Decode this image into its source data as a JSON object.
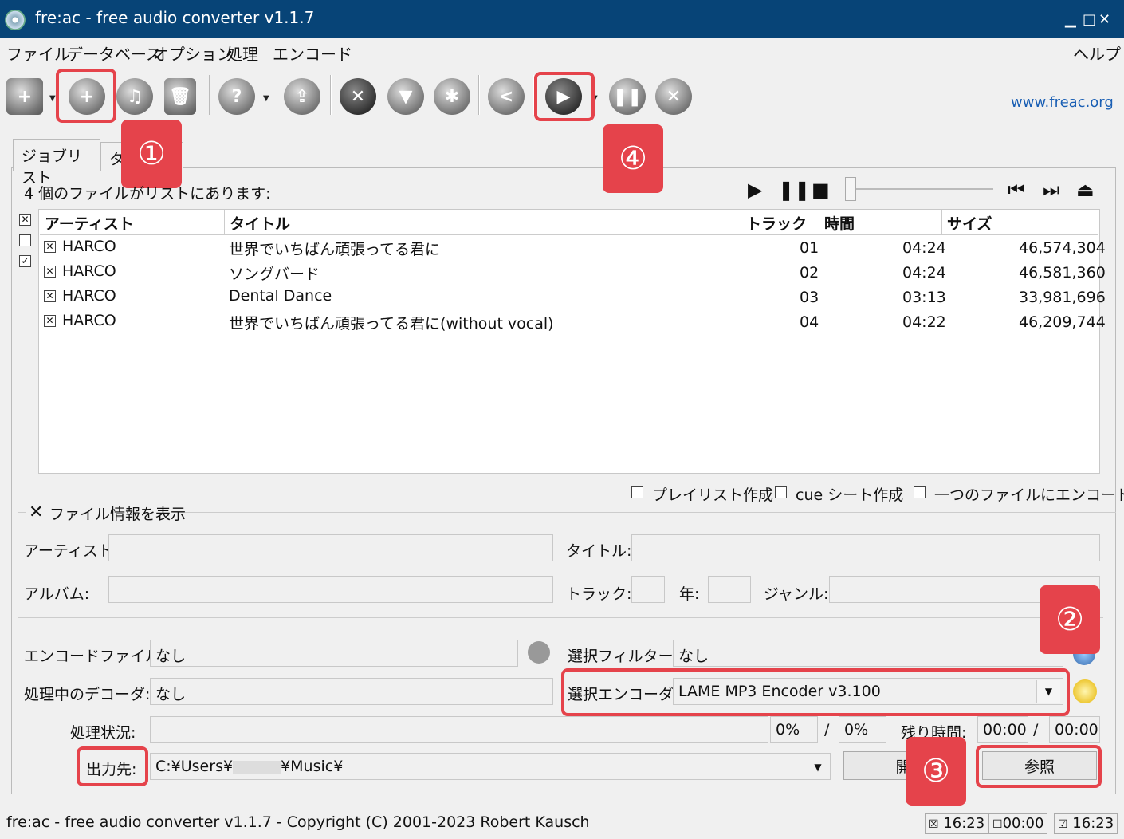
{
  "window": {
    "title": "fre:ac - free audio converter v1.1.7"
  },
  "menu": [
    "ファイル",
    "データベース",
    "オプション",
    "処理",
    "エンコード",
    "ヘルプ"
  ],
  "toolbar": {
    "link": "www.freac.org"
  },
  "badges": {
    "b1": "①",
    "b2": "②",
    "b3": "③",
    "b4": "④"
  },
  "tabs": {
    "joblist": "ジョブリスト",
    "second": "タ"
  },
  "joblist": {
    "count_text": "4 個のファイルがリストにあります:",
    "columns": {
      "artist": "アーティスト",
      "title": "タイトル",
      "track": "トラック",
      "time": "時間",
      "size": "サイズ"
    },
    "rows": [
      {
        "artist": "HARCO",
        "title": "世界でいちばん頑張ってる君に",
        "track": "01",
        "time": "04:24",
        "size": "46,574,304"
      },
      {
        "artist": "HARCO",
        "title": "ソングバード",
        "track": "02",
        "time": "04:24",
        "size": "46,581,360"
      },
      {
        "artist": "HARCO",
        "title": "Dental Dance",
        "track": "03",
        "time": "03:13",
        "size": "33,981,696"
      },
      {
        "artist": "HARCO",
        "title": "世界でいちばん頑張ってる君に(without vocal)",
        "track": "04",
        "time": "04:22",
        "size": "46,209,744"
      }
    ]
  },
  "options": {
    "playlist": "プレイリスト作成",
    "cue": "cue シート作成",
    "single": "一つのファイルにエンコード"
  },
  "fileinfo": {
    "header": "ファイル情報を表示",
    "artist": "アーティスト:",
    "title": "タイトル:",
    "album": "アルバム:",
    "track": "トラック:",
    "year": "年:",
    "genre": "ジャンル:"
  },
  "encode": {
    "encode_file_label": "エンコードファイル:",
    "encode_file_value": "なし",
    "filter_label": "選択フィルター:",
    "filter_value": "なし",
    "decoder_label": "処理中のデコーダ:",
    "decoder_value": "なし",
    "encoder_label": "選択エンコーダ:",
    "encoder_value": "LAME MP3 Encoder v3.100",
    "progress_label": "処理状況:",
    "progress_file": "0%",
    "slash": "/",
    "progress_total": "0%",
    "remaining_label": "残り時間:",
    "remaining_file": "00:00",
    "remaining_total": "00:00",
    "output_label": "出力先:",
    "output_path_a": "C:¥Users¥",
    "output_path_b": "¥Music¥",
    "open_button": "開",
    "browse_button": "参照"
  },
  "statusbar": {
    "text": "fre:ac - free audio converter v1.1.7 - Copyright (C) 2001-2023 Robert Kausch",
    "t1": "16:23",
    "t2": "00:00",
    "t3": "16:23"
  },
  "colors": {
    "accent": "#e5434b",
    "titlebar": "#074477"
  }
}
